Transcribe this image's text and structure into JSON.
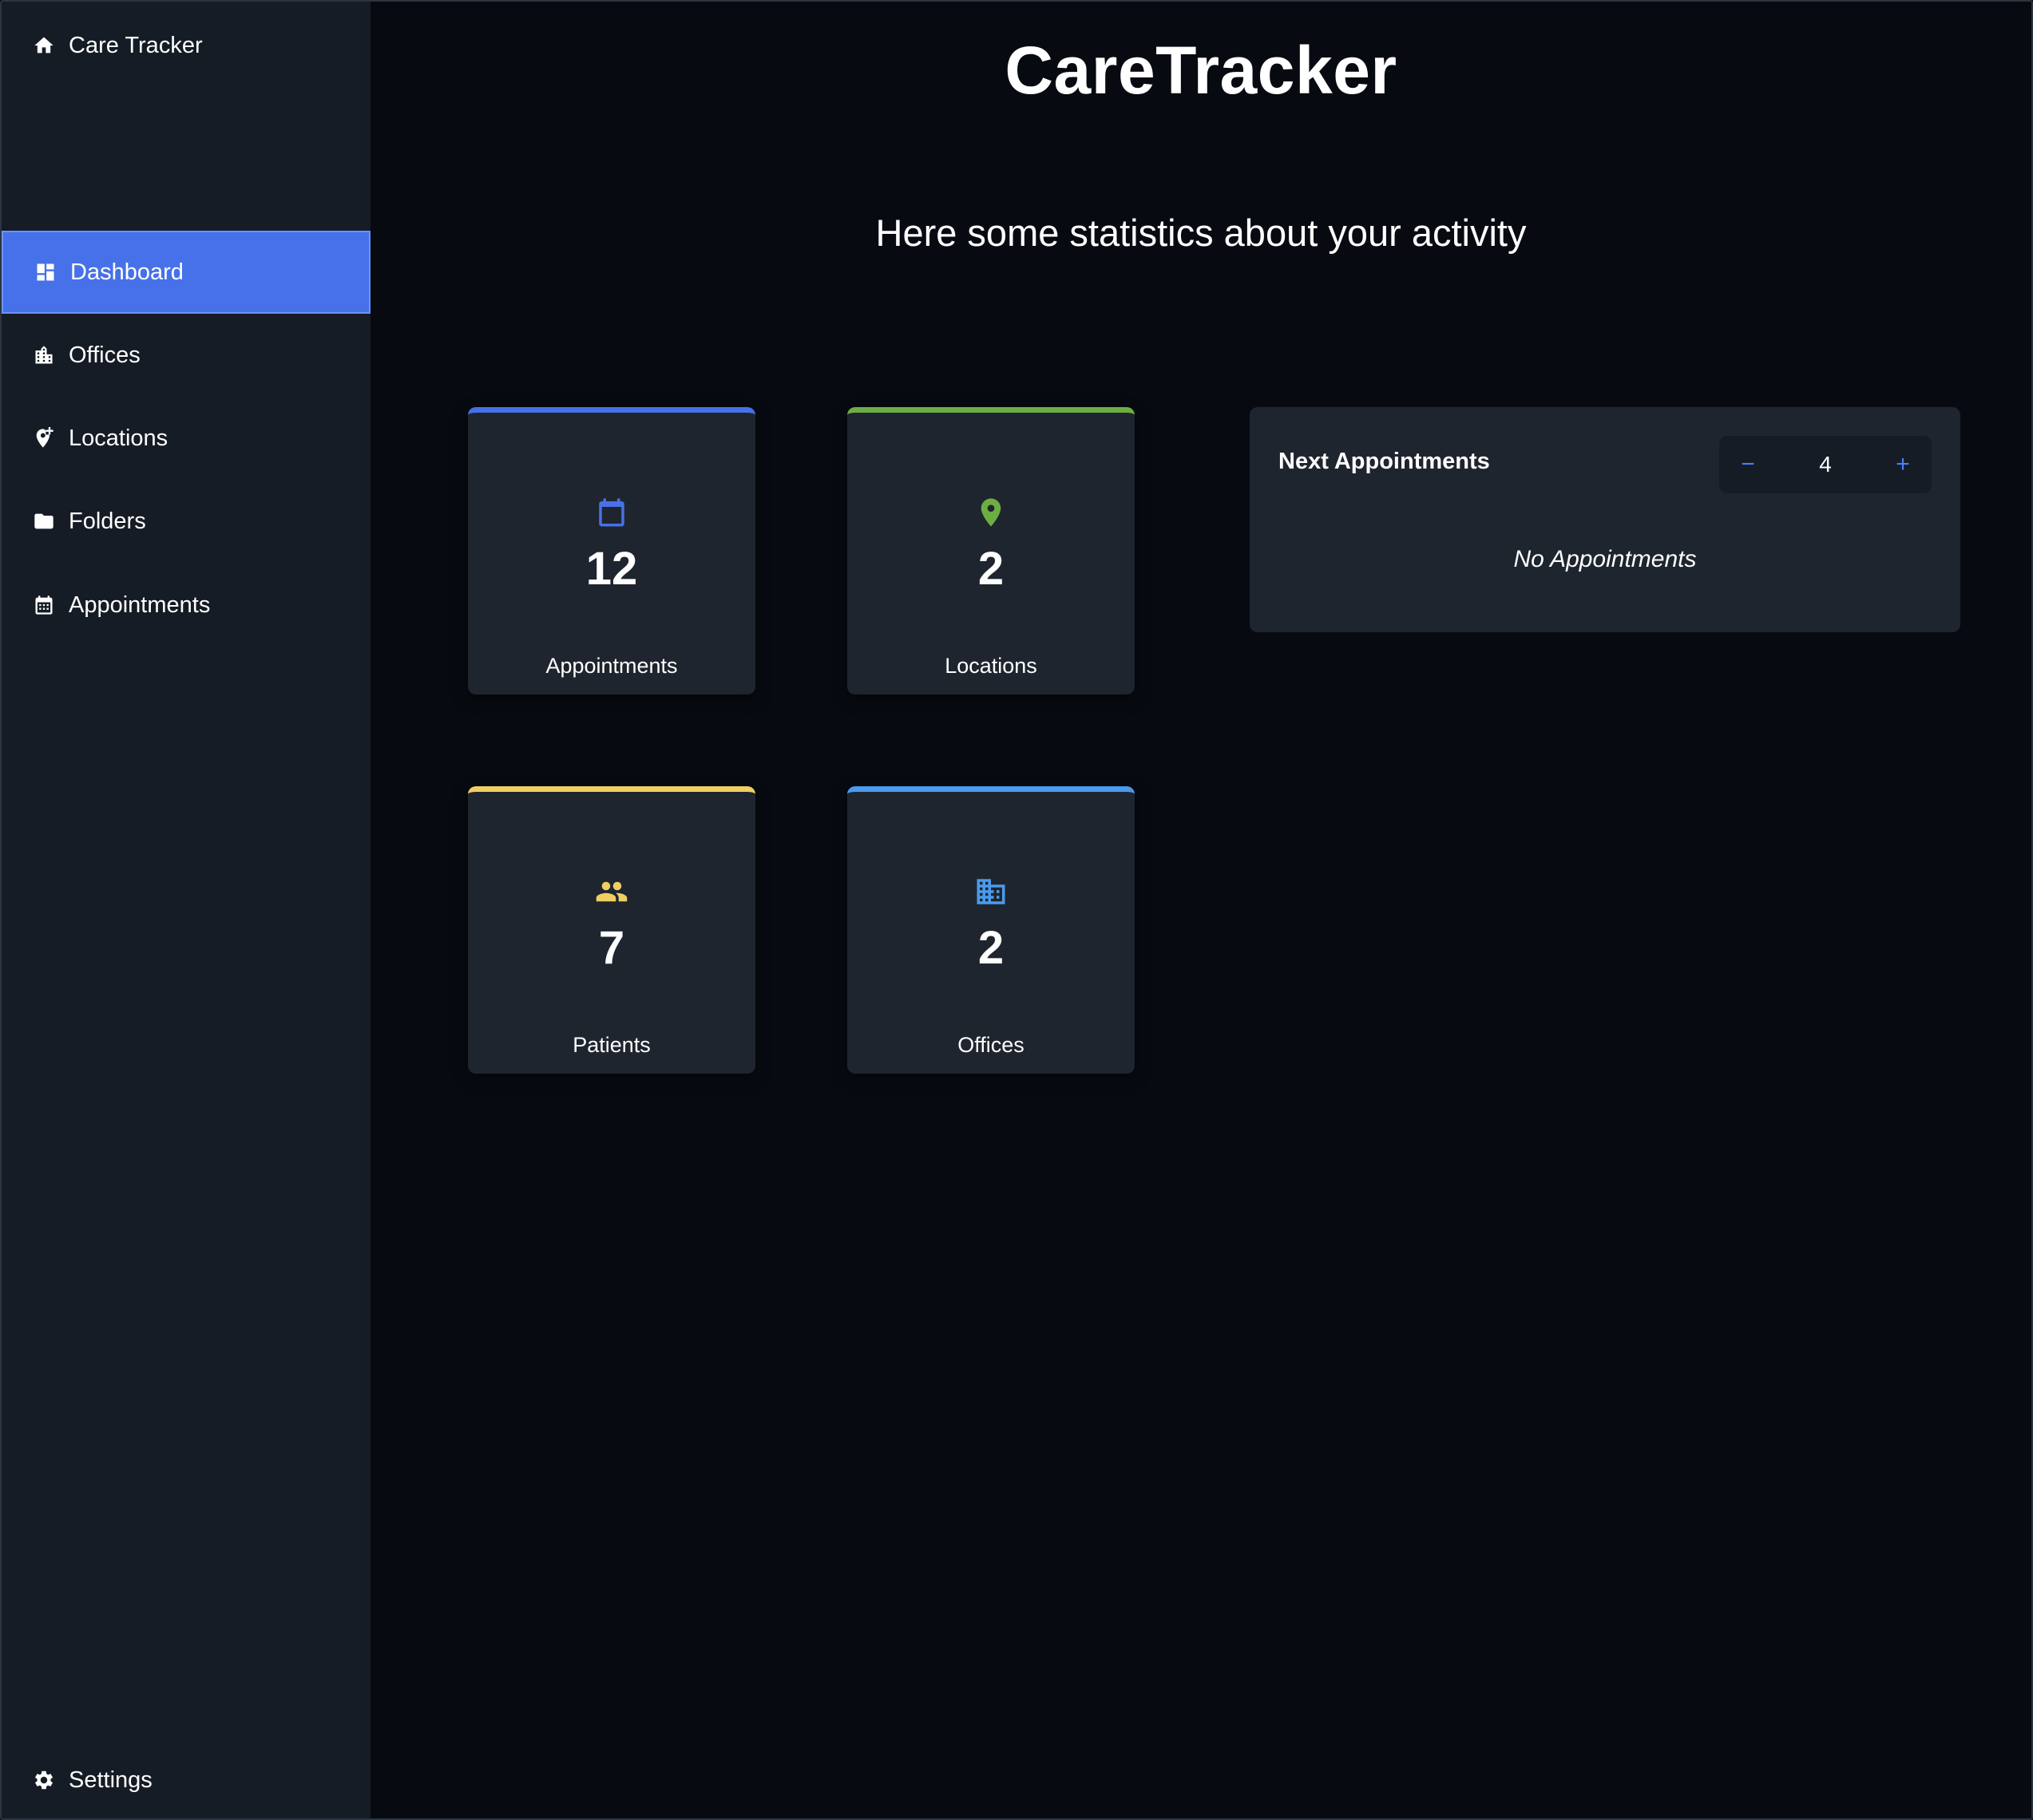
{
  "sidebar": {
    "brand": "Care Tracker",
    "items": [
      {
        "label": "Dashboard",
        "icon": "dashboard-icon",
        "active": true
      },
      {
        "label": "Offices",
        "icon": "offices-icon"
      },
      {
        "label": "Locations",
        "icon": "add-location-icon"
      },
      {
        "label": "Folders",
        "icon": "folder-icon"
      },
      {
        "label": "Appointments",
        "icon": "calendar-icon"
      }
    ],
    "settings_label": "Settings"
  },
  "main": {
    "title": "CareTracker",
    "subtitle": "Here some statistics about your activity",
    "stats": [
      {
        "value": "12",
        "label": "Appointments",
        "icon": "calendar-icon",
        "color": "#4671e9"
      },
      {
        "value": "2",
        "label": "Locations",
        "icon": "location-pin-icon",
        "color": "#6dae43"
      },
      {
        "value": "7",
        "label": "Patients",
        "icon": "people-icon",
        "color": "#f0cf62"
      },
      {
        "value": "2",
        "label": "Offices",
        "icon": "building-icon",
        "color": "#4a9bee"
      }
    ],
    "next_appointments": {
      "title": "Next Appointments",
      "count": "4",
      "minus_label": "−",
      "plus_label": "+",
      "empty_text": "No Appointments"
    }
  },
  "colors": {
    "sidebar_bg": "#161c25",
    "main_bg": "#070b11",
    "card_bg": "#1f252e",
    "accent": "#4671e9"
  }
}
